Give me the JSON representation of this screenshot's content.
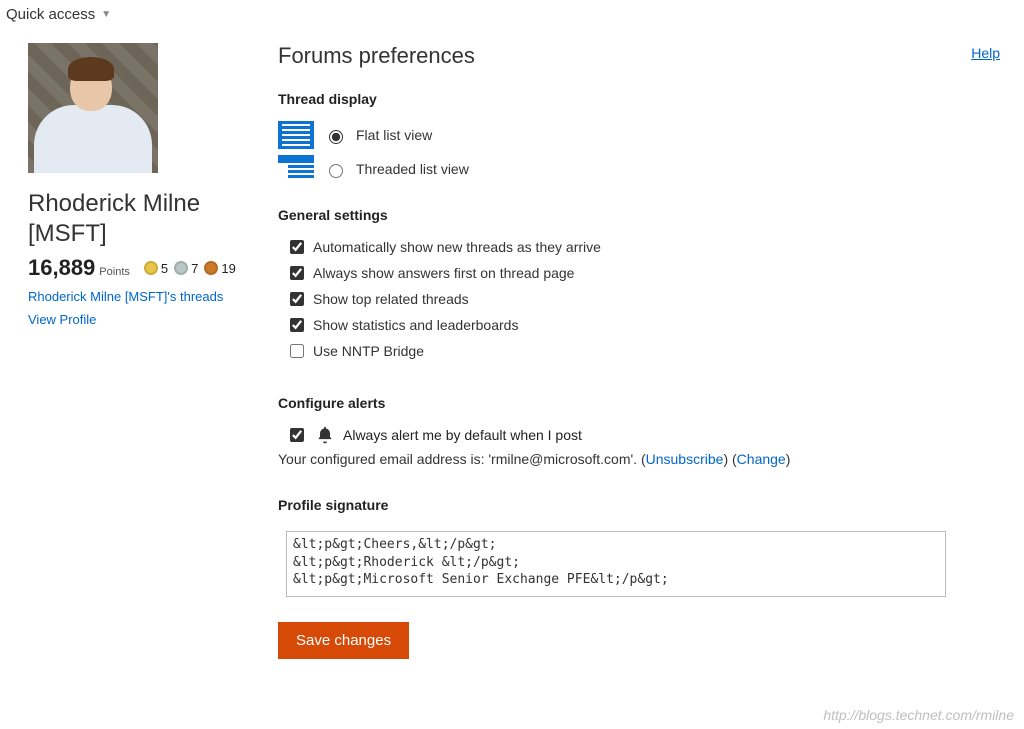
{
  "quick_access": {
    "label": "Quick access"
  },
  "profile": {
    "name": "Rhoderick Milne [MSFT]",
    "points_value": "16,889",
    "points_label": "Points",
    "medals": {
      "gold": "5",
      "silver": "7",
      "bronze": "19"
    },
    "threads_link": "Rhoderick Milne [MSFT]'s threads",
    "view_profile": "View Profile"
  },
  "help_label": "Help",
  "page_title": "Forums preferences",
  "sections": {
    "thread_display": {
      "title": "Thread display",
      "flat": "Flat list view",
      "threaded": "Threaded list view"
    },
    "general": {
      "title": "General settings",
      "auto_new": "Automatically show new threads as they arrive",
      "answers_first": "Always show answers first on thread page",
      "top_related": "Show top related threads",
      "stats": "Show statistics and leaderboards",
      "nntp": "Use NNTP Bridge"
    },
    "alerts": {
      "title": "Configure alerts",
      "always_alert": "Always alert me by default when I post",
      "email_prefix": "Your configured email address is: 'rmilne@microsoft.com'. (",
      "unsubscribe": "Unsubscribe",
      "mid": ") (",
      "change": "Change",
      "suffix": ")"
    },
    "signature": {
      "title": "Profile signature",
      "value": "&lt;p&gt;Cheers,&lt;/p&gt;\n&lt;p&gt;Rhoderick &lt;/p&gt;\n&lt;p&gt;Microsoft Senior Exchange PFE&lt;/p&gt;"
    }
  },
  "save_label": "Save changes",
  "watermark": "http://blogs.technet.com/rmilne"
}
